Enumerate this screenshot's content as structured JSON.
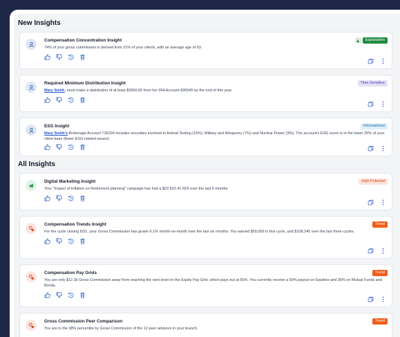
{
  "sections": {
    "new_title": "New Insights",
    "all_title": "All Insights"
  },
  "cards": [
    {
      "title": "Compensation Concentration Insight",
      "badge": "Explanation",
      "body": "74% of your gross commission is derived from 21% of your clients, with an average age of 63."
    },
    {
      "title": "Required Minimum Distribution Insight",
      "badge": "Time-Sensitive",
      "body_link": "Mary Smith",
      "body": ", must make a distribution of at least $3560.82 from her IRA Account 836545 by the end of this year."
    },
    {
      "title": "ESG Insight",
      "badge": "Informational",
      "body_link": "Mary Smith's",
      "body": " Brokerage Account 736234 includes securities involved in Animal Testing (16%), Military and Weaponry (7%) and Nuclear Power (3%). The account's ESG score is in the lower 25% of your client base (fewer ESG-related issues)"
    },
    {
      "title": "Digital Marketing Insight",
      "badge": "High Potential",
      "body": "Your \"Impact of Inflation on Retirement planning\" campaign has had a $22,922.41 ROI over the last 6 months"
    },
    {
      "title": "Compensation Trends Insight",
      "badge": "Trend",
      "body": "For the cycle closing 6/31, your Gross Commission has grown 6.1% month-on-month over the last six months. You earned $50,059 in this cycle, and $108,345 over the last three cycles."
    },
    {
      "title": "Compensation Pay Grids",
      "badge": "Trend",
      "body": "You are only $12.3k Gross Commission away from reaching the next level on the Equity Pay Grid, which pays out at 55%. You currently receive a 50% payout on Equities and 35% on Mutual Funds and Bonds."
    },
    {
      "title": "Gross Commission Peer Comparison",
      "badge": "Trend",
      "body": "You are in the 38% percentile by Gross Commission of the 12 peer advisors in your branch."
    }
  ],
  "colors": {
    "explanation": "#1f8a3f",
    "time_sensitive": "#4b3aa8",
    "informational": "#1e6fa8",
    "high_potential": "#d9481c",
    "trend": "#ef5d1a"
  },
  "icons": {
    "person": "person-icon",
    "marketing": "megaphone-icon",
    "trend": "trend-icon",
    "thumbs_up": "thumbs-up-icon",
    "thumbs_down": "thumbs-down-icon",
    "snooze": "snooze-icon",
    "delete": "trash-icon",
    "copy": "copy-icon",
    "more": "more-vertical-icon"
  }
}
